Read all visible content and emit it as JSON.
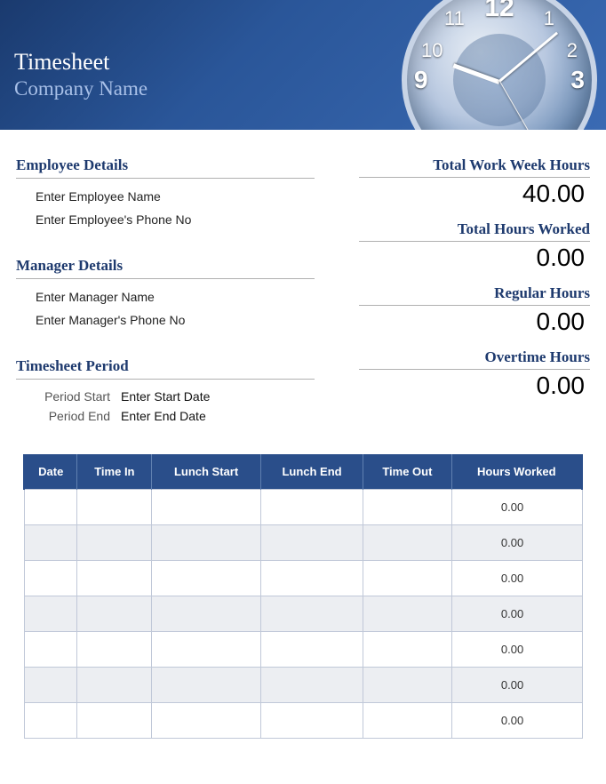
{
  "header": {
    "title": "Timesheet",
    "subtitle": "Company Name"
  },
  "employee": {
    "heading": "Employee Details",
    "name_placeholder": "Enter Employee Name",
    "phone_placeholder": "Enter Employee's Phone No"
  },
  "manager": {
    "heading": "Manager Details",
    "name_placeholder": "Enter Manager Name",
    "phone_placeholder": "Enter Manager's Phone No"
  },
  "period": {
    "heading": "Timesheet Period",
    "start_label": "Period Start",
    "start_value": "Enter Start Date",
    "end_label": "Period End",
    "end_value": "Enter End Date"
  },
  "totals": {
    "work_week_label": "Total Work Week Hours",
    "work_week_value": "40.00",
    "hours_worked_label": "Total Hours Worked",
    "hours_worked_value": "0.00",
    "regular_label": "Regular Hours",
    "regular_value": "0.00",
    "overtime_label": "Overtime Hours",
    "overtime_value": "0.00"
  },
  "table": {
    "headers": [
      "Date",
      "Time In",
      "Lunch Start",
      "Lunch End",
      "Time Out",
      "Hours Worked"
    ],
    "rows": [
      {
        "date": "",
        "time_in": "",
        "lunch_start": "",
        "lunch_end": "",
        "time_out": "",
        "hours": "0.00"
      },
      {
        "date": "",
        "time_in": "",
        "lunch_start": "",
        "lunch_end": "",
        "time_out": "",
        "hours": "0.00"
      },
      {
        "date": "",
        "time_in": "",
        "lunch_start": "",
        "lunch_end": "",
        "time_out": "",
        "hours": "0.00"
      },
      {
        "date": "",
        "time_in": "",
        "lunch_start": "",
        "lunch_end": "",
        "time_out": "",
        "hours": "0.00"
      },
      {
        "date": "",
        "time_in": "",
        "lunch_start": "",
        "lunch_end": "",
        "time_out": "",
        "hours": "0.00"
      },
      {
        "date": "",
        "time_in": "",
        "lunch_start": "",
        "lunch_end": "",
        "time_out": "",
        "hours": "0.00"
      },
      {
        "date": "",
        "time_in": "",
        "lunch_start": "",
        "lunch_end": "",
        "time_out": "",
        "hours": "0.00"
      }
    ]
  }
}
